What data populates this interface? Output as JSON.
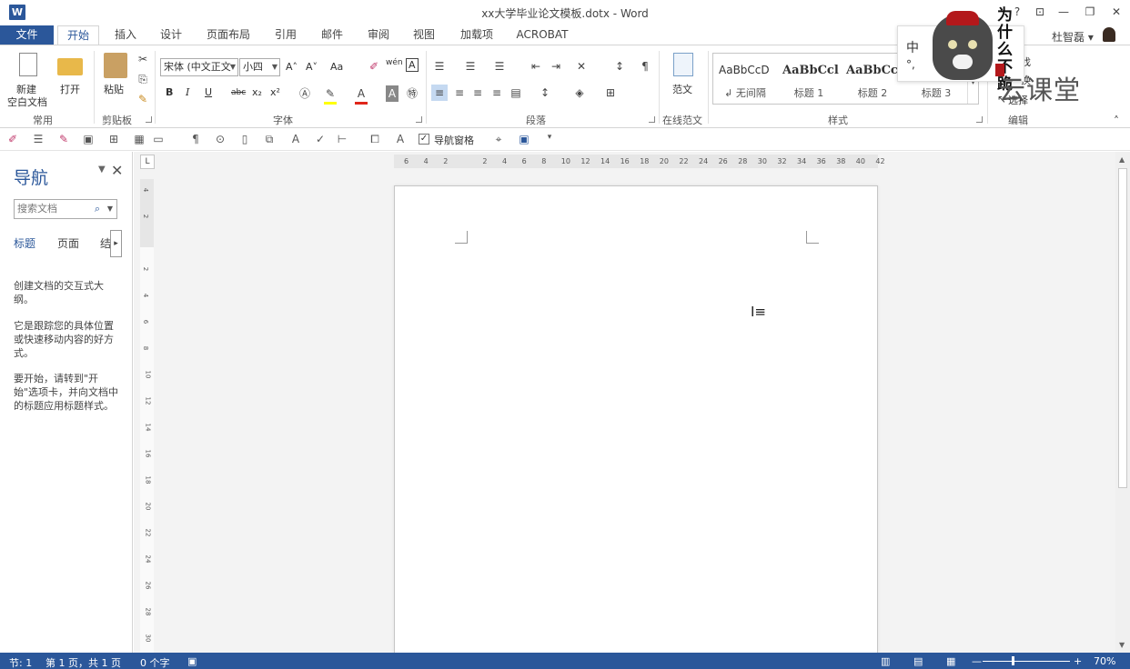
{
  "window": {
    "title": "xx大学毕业论文模板.dotx - Word",
    "app_icon": "W"
  },
  "tabs": [
    "文件",
    "开始",
    "插入",
    "设计",
    "页面布局",
    "引用",
    "邮件",
    "审阅",
    "视图",
    "加载项",
    "ACROBAT"
  ],
  "user": {
    "name": "杜智磊 ▾"
  },
  "ribbon": {
    "clipboard": {
      "new_blank_1": "新建",
      "new_blank_2": "空白文档",
      "open": "打开",
      "paste": "粘贴",
      "common_label": "常用",
      "clipboard_label": "剪贴板"
    },
    "font": {
      "name": "宋体 (中文正文",
      "size": "小四",
      "label": "字体",
      "bold": "B",
      "italic": "I",
      "underline": "U",
      "strike": "abc",
      "sub": "x₂",
      "sup": "x²",
      "grow": "A˄",
      "shrink": "A˅",
      "case": "Aa",
      "phonetic": "wén",
      "border_char": "A"
    },
    "paragraph": {
      "label": "段落"
    },
    "template": {
      "fanwen": "范文",
      "label": "在线范文"
    },
    "styles": {
      "label": "样式",
      "items": [
        {
          "sample": "AaBbCcD",
          "name": "↲ 无间隔"
        },
        {
          "sample": "AaBbCcl",
          "name": "标题 1"
        },
        {
          "sample": "AaBbCcl",
          "name": "标题 2"
        },
        {
          "sample": "",
          "name": "标题 3"
        }
      ]
    },
    "editing": {
      "find": "找",
      "replace": "换",
      "select": "选择",
      "label": "编辑"
    }
  },
  "toolbar2": {
    "nav_pane_check": "✓",
    "nav_pane_label": "导航窗格"
  },
  "nav": {
    "title": "导航",
    "search_placeholder": "搜索文档",
    "tabs": {
      "headings": "标题",
      "pages": "页面",
      "results": "结果"
    },
    "text1": "创建文档的交互式大纲。",
    "text2": "它是跟踪您的具体位置或快速移动内容的好方式。",
    "text3": "要开始，请转到\"开始\"选项卡，并向文档中的标题应用标题样式。"
  },
  "ruler": {
    "corner": "L",
    "h_labels": [
      "6",
      "4",
      "2",
      "",
      "2",
      "4",
      "6",
      "8",
      "10",
      "12",
      "14",
      "16",
      "18",
      "20",
      "22",
      "24",
      "26",
      "28",
      "30",
      "32",
      "34",
      "36",
      "38",
      "40",
      "42"
    ],
    "v_labels": [
      "4",
      "2",
      "",
      "2",
      "4",
      "6",
      "8",
      "10",
      "12",
      "14",
      "16",
      "18",
      "20",
      "22",
      "24",
      "26",
      "28",
      "30"
    ]
  },
  "status": {
    "section": "节: 1",
    "page": "第 1 页，共 1 页",
    "words": "0 个字",
    "zoom": "70%"
  },
  "overlay": {
    "ime_top": "中",
    "ime_bottom": "°,",
    "calligraphy": "为什么不跪",
    "watermark": "云课堂"
  },
  "colors": {
    "accent": "#2b579a",
    "seal": "#b3181b"
  }
}
